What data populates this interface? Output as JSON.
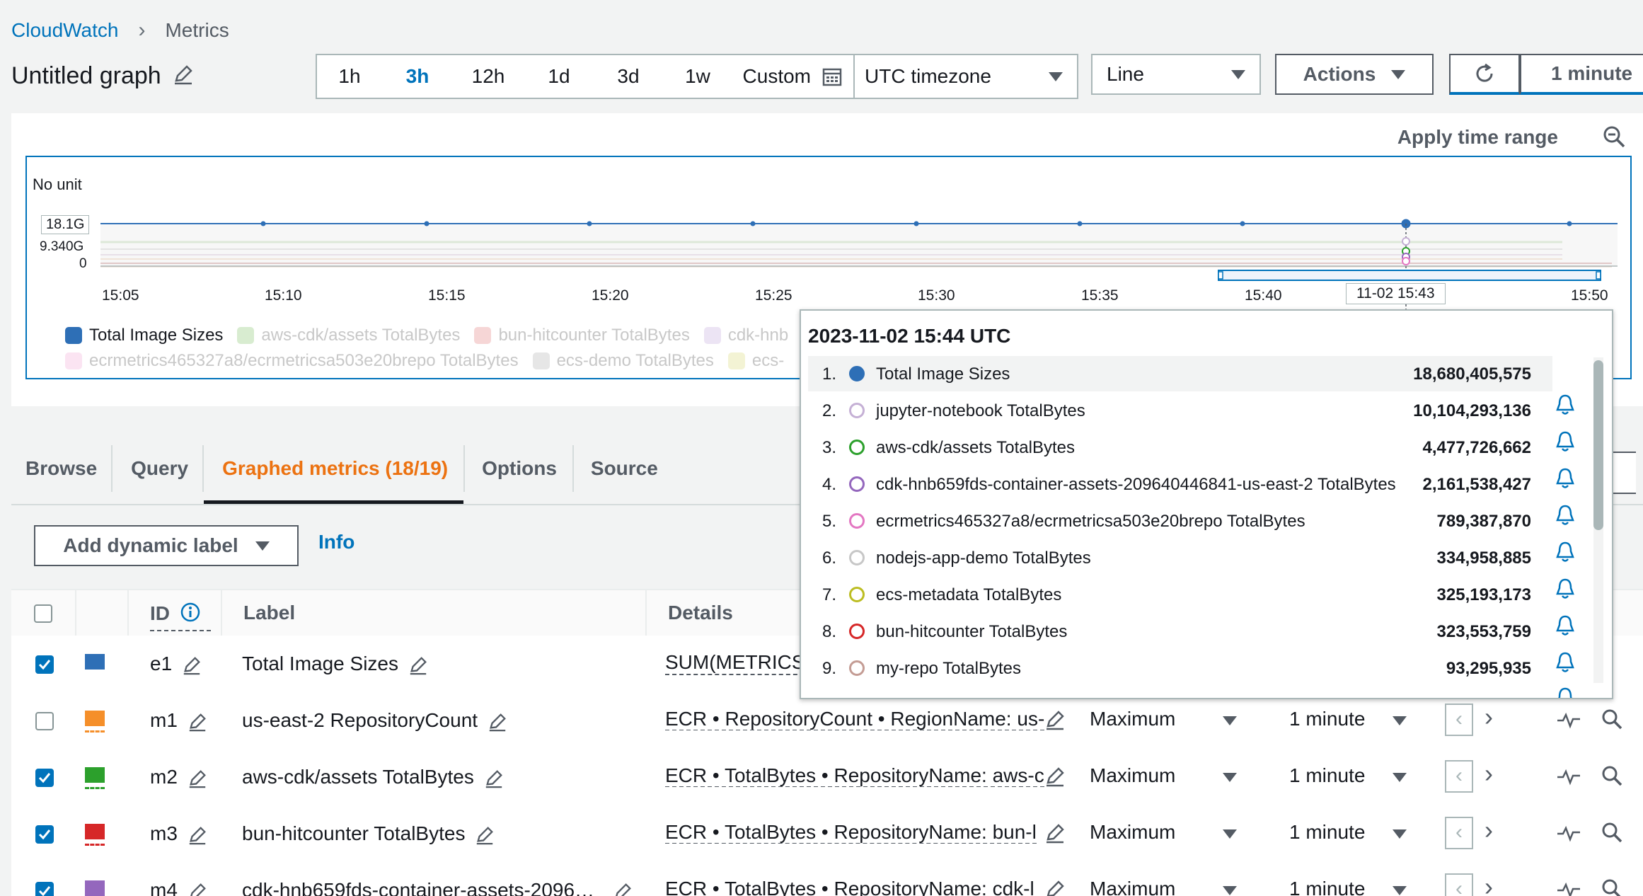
{
  "breadcrumb": {
    "root": "CloudWatch",
    "current": "Metrics"
  },
  "graph_title": "Untitled graph",
  "time_range": {
    "options": [
      "1h",
      "3h",
      "12h",
      "1d",
      "3d",
      "1w"
    ],
    "active": "3h",
    "custom_label": "Custom",
    "timezone": "UTC timezone"
  },
  "chart_type": "Line",
  "actions_label": "Actions",
  "refresh_interval": "1 minute",
  "apply_time_range": "Apply time range",
  "chart": {
    "unit_label": "No unit",
    "y_ticks": [
      "18.1G",
      "9.340G",
      "0"
    ],
    "x_ticks": [
      "15:05",
      "15:10",
      "15:15",
      "15:20",
      "15:25",
      "15:30",
      "15:35",
      "15:40",
      "15:50"
    ],
    "hover_time_label": "11-02 15:43"
  },
  "legend": [
    {
      "label": "Total Image Sizes",
      "color": "#2e6fb6",
      "faded": false
    },
    {
      "label": "aws-cdk/assets TotalBytes",
      "color": "#2ca02c",
      "faded": true
    },
    {
      "label": "bun-hitcounter TotalBytes",
      "color": "#d62728",
      "faded": true
    },
    {
      "label": "cdk-hnb",
      "color": "#9467bd",
      "faded": true
    },
    {
      "label": "ecrmetrics465327a8/ecrmetricsa503e20brepo TotalBytes",
      "color": "#e377c2",
      "faded": true
    },
    {
      "label": "ecs-demo TotalBytes",
      "color": "#7f7f7f",
      "faded": true
    },
    {
      "label": "ecs-",
      "color": "#bcbd22",
      "faded": true
    }
  ],
  "tabs": [
    "Browse",
    "Query",
    "Graphed metrics (18/19)",
    "Options",
    "Source"
  ],
  "active_tab": "Graphed metrics (18/19)",
  "dynamic_label_button": "Add dynamic label",
  "info_link": "Info",
  "table": {
    "headers": {
      "id": "ID",
      "label": "Label",
      "details": "Details"
    },
    "rows": [
      {
        "checked": true,
        "color": "#2e6fb6",
        "style": "solid",
        "id": "e1",
        "label": "Total Image Sizes",
        "details": "SUM(METRICS(",
        "stat": "",
        "period": ""
      },
      {
        "checked": false,
        "color": "#f58f2a",
        "style": "dashed",
        "id": "m1",
        "label": "us-east-2 RepositoryCount",
        "details": "ECR • RepositoryCount • RegionName: us-",
        "stat": "Maximum",
        "period": "1 minute"
      },
      {
        "checked": true,
        "color": "#2ca02c",
        "style": "dashed",
        "id": "m2",
        "label": "aws-cdk/assets TotalBytes",
        "details": "ECR • TotalBytes • RepositoryName: aws-c",
        "stat": "Maximum",
        "period": "1 minute"
      },
      {
        "checked": true,
        "color": "#d62728",
        "style": "dashed",
        "id": "m3",
        "label": "bun-hitcounter TotalBytes",
        "details": "ECR • TotalBytes • RepositoryName: bun-l",
        "stat": "Maximum",
        "period": "1 minute"
      },
      {
        "checked": true,
        "color": "#9467bd",
        "style": "dashed",
        "id": "m4",
        "label": "cdk-hnb659fds-container-assets-2096…",
        "details": "ECR • TotalBytes • RepositoryName: cdk-l",
        "stat": "Maximum",
        "period": "1 minute"
      }
    ]
  },
  "tooltip": {
    "timestamp": "2023-11-02 15:44 UTC",
    "items": [
      {
        "rank": "1.",
        "label": "Total Image Sizes",
        "value": "18,680,405,575",
        "color": "#2e6fb6",
        "filled": true
      },
      {
        "rank": "2.",
        "label": "jupyter-notebook TotalBytes",
        "value": "10,104,293,136",
        "color": "#c5b0d5",
        "filled": false
      },
      {
        "rank": "3.",
        "label": "aws-cdk/assets TotalBytes",
        "value": "4,477,726,662",
        "color": "#2ca02c",
        "filled": false
      },
      {
        "rank": "4.",
        "label": "cdk-hnb659fds-container-assets-209640446841-us-east-2 TotalBytes",
        "value": "2,161,538,427",
        "color": "#9467bd",
        "filled": false
      },
      {
        "rank": "5.",
        "label": "ecrmetrics465327a8/ecrmetricsa503e20brepo TotalBytes",
        "value": "789,387,870",
        "color": "#e377c2",
        "filled": false
      },
      {
        "rank": "6.",
        "label": "nodejs-app-demo TotalBytes",
        "value": "334,958,885",
        "color": "#c7c7c7",
        "filled": false
      },
      {
        "rank": "7.",
        "label": "ecs-metadata TotalBytes",
        "value": "325,193,173",
        "color": "#bcbd22",
        "filled": false
      },
      {
        "rank": "8.",
        "label": "bun-hitcounter TotalBytes",
        "value": "323,553,759",
        "color": "#d62728",
        "filled": false
      },
      {
        "rank": "9.",
        "label": "my-repo TotalBytes",
        "value": "93,295,935",
        "color": "#c49c94",
        "filled": false
      }
    ]
  }
}
